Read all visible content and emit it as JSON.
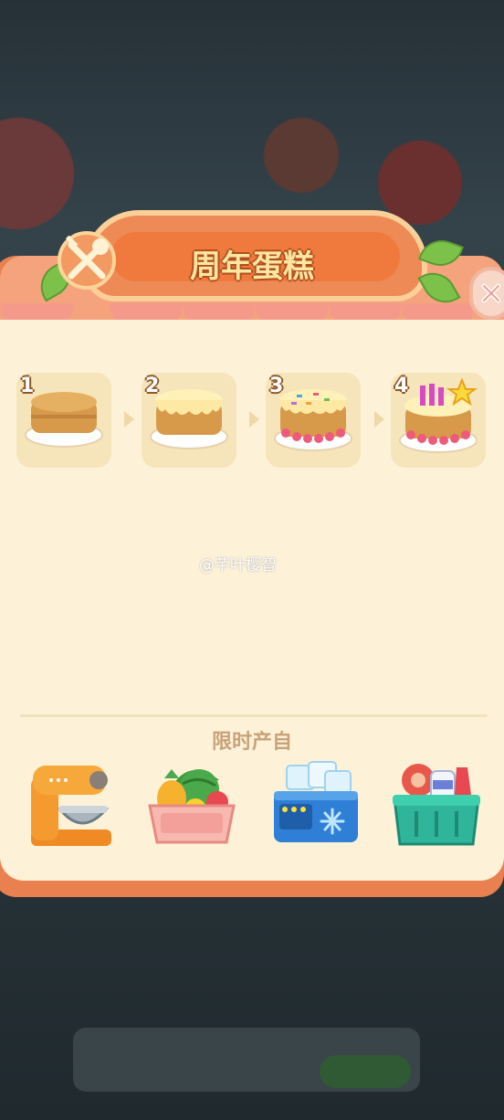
{
  "dialog": {
    "title": "周年蛋糕",
    "close_icon": "close-icon"
  },
  "stages": [
    {
      "number": "1",
      "icon": "sponge-cake-icon"
    },
    {
      "number": "2",
      "icon": "cream-cake-icon"
    },
    {
      "number": "3",
      "icon": "sprinkle-cake-icon"
    },
    {
      "number": "4",
      "icon": "candle-cake-icon"
    }
  ],
  "source": {
    "label": "限时产自",
    "producers": [
      {
        "icon": "stand-mixer-icon"
      },
      {
        "icon": "fruit-basket-icon"
      },
      {
        "icon": "ice-freezer-icon"
      },
      {
        "icon": "grocery-basket-icon"
      }
    ]
  },
  "watermark": "@芊叶樱智",
  "colors": {
    "panel_frame": "#e98050",
    "panel_body": "#fdf2d8",
    "title_text": "#fde7a1",
    "label_text": "#c9a27a"
  }
}
